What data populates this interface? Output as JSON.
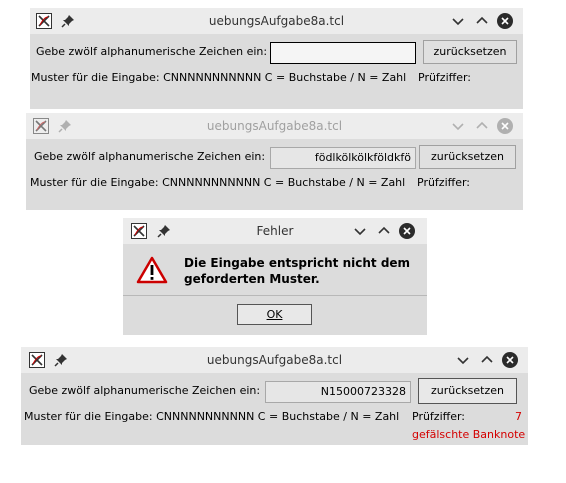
{
  "window1": {
    "title": "uebungsAufgabe8a.tcl",
    "prompt_label": "Gebe zwölf alphanumerische Zeichen ein:",
    "entry_value": "",
    "reset_button": "zurücksetzen",
    "pattern_label": "Muster für die Eingabe: CNNNNNNNNNNN  C = Buchstabe / N = Zahl",
    "check_label": "Prüfziffer:"
  },
  "window2": {
    "title": "uebungsAufgabe8a.tcl",
    "prompt_label": "Gebe zwölf alphanumerische Zeichen ein:",
    "entry_value": "födlkölkölkföldkfö",
    "reset_button": "zurücksetzen",
    "pattern_label": "Muster für die Eingabe: CNNNNNNNNNNN  C = Buchstabe / N = Zahl",
    "check_label": "Prüfziffer:"
  },
  "error_dialog": {
    "title": "Fehler",
    "message": "Die Eingabe entspricht nicht dem geforderten Muster.",
    "ok_button": "OK"
  },
  "window3": {
    "title": "uebungsAufgabe8a.tcl",
    "prompt_label": "Gebe zwölf alphanumerische Zeichen ein:",
    "entry_value": "N15000723328",
    "reset_button": "zurücksetzen",
    "pattern_label": "Muster für die Eingabe: CNNNNNNNNNNN  C = Buchstabe / N = Zahl",
    "check_label": "Prüfziffer:",
    "check_value": "7",
    "result_text": "gefälschte Banknote"
  },
  "colors": {
    "error_red": "#d40000",
    "close_active": "#2b2b2b",
    "close_inactive": "#b0b0b0"
  },
  "icons": [
    "app-icon",
    "pin-icon",
    "minimize-icon",
    "maximize-icon",
    "close-icon",
    "warning-icon"
  ]
}
